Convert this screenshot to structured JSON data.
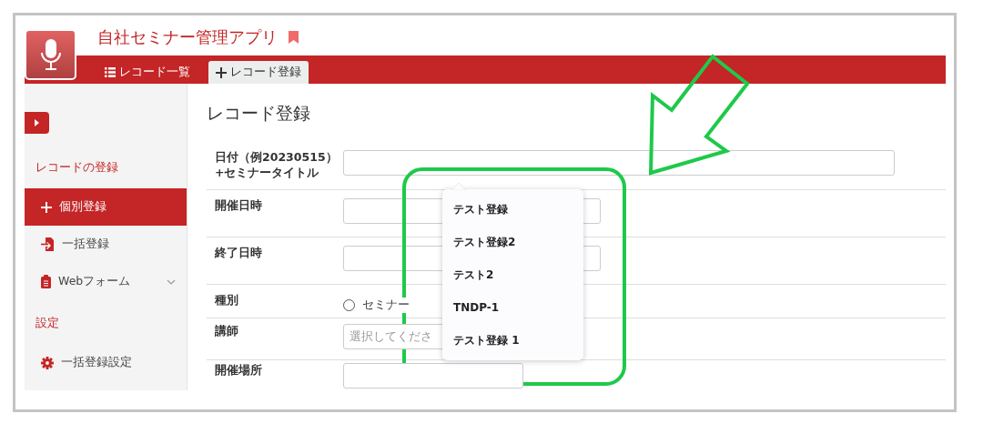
{
  "app": {
    "title": "自社セミナー管理アプリ",
    "bookmarked": true
  },
  "tabs": [
    {
      "label": "レコード一覧",
      "kind": "list",
      "selected": false
    },
    {
      "label": "レコード登録",
      "kind": "plus",
      "selected": true
    }
  ],
  "sidebar": {
    "sections": [
      {
        "title": "レコードの登録",
        "items": [
          {
            "label": "個別登録",
            "kind": "plus",
            "selected": true,
            "expandable": false
          },
          {
            "label": "一括登録",
            "kind": "import",
            "selected": false,
            "expandable": false
          },
          {
            "label": "Webフォーム",
            "kind": "clipboard",
            "selected": false,
            "expandable": true
          }
        ]
      },
      {
        "title": "設定",
        "items": [
          {
            "label": "一括登録設定",
            "kind": "gear",
            "selected": false,
            "expandable": false
          }
        ]
      }
    ]
  },
  "form": {
    "heading": "レコード登録",
    "rows": [
      {
        "kind": "text",
        "label": "日付（例20230515）\n+セミナータイトル"
      },
      {
        "kind": "text",
        "label": "開催日時"
      },
      {
        "kind": "text",
        "label": "終了日時"
      },
      {
        "kind": "radio",
        "label": "種別",
        "option": "セミナー",
        "checked": false
      },
      {
        "kind": "select",
        "label": "講師",
        "placeholder": "選択してくださ"
      },
      {
        "kind": "select",
        "label": "開催場所"
      }
    ]
  },
  "dropdown": {
    "items": [
      "テスト登録",
      "テスト登録2",
      "テスト2",
      "TNDP-1",
      "テスト登録 1"
    ]
  },
  "annotations": {
    "arrow": true,
    "highlight_frame": true
  }
}
